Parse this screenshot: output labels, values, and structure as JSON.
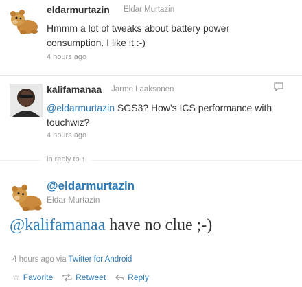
{
  "tweet1": {
    "screen_name": "eldarmurtazin",
    "full_name": "Eldar Murtazin",
    "text": "Hmmm a lot of tweaks about battery power consumption. I like it :-)",
    "time": "4 hours ago"
  },
  "tweet2": {
    "screen_name": "kalifamanaa",
    "full_name": "Jarmo Laaksonen",
    "mention": "@eldarmurtazin",
    "text": " SGS3? How's ICS performance with touchwiz?",
    "time": "4 hours ago"
  },
  "in_reply_to": "in reply to ↑",
  "main_tweet": {
    "screen_name": "@eldarmurtazin",
    "full_name": "Eldar Murtazin",
    "mention": "@kalifamanaa",
    "text": " have no clue ;-)",
    "time": "4 hours ago via ",
    "source": "Twitter for Android"
  },
  "actions": {
    "favorite": "Favorite",
    "retweet": "Retweet",
    "reply": "Reply"
  },
  "icons": {
    "favorite": "star-icon",
    "retweet": "retweet-icon",
    "reply": "reply-arrow-icon",
    "conversation": "speech-bubble-icon"
  },
  "colors": {
    "link": "#2b7bb9",
    "muted": "#999999",
    "text": "#333333"
  }
}
